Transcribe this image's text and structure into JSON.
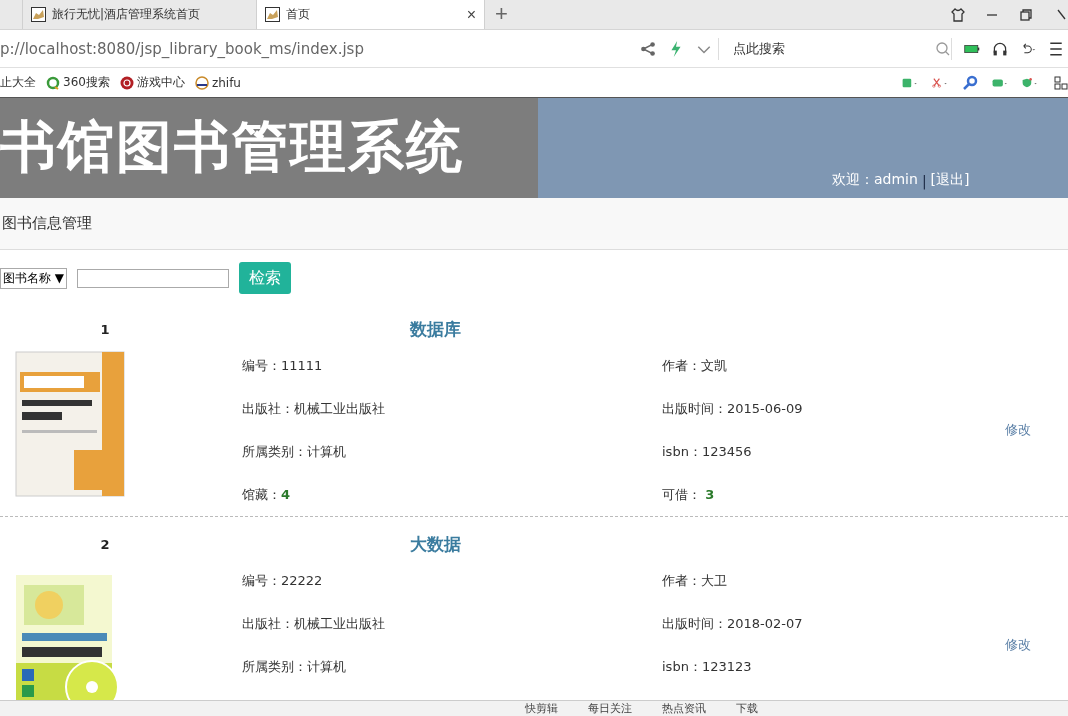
{
  "browser": {
    "tabs": [
      {
        "title": "旅行无忧|酒店管理系统首页",
        "selected": false
      },
      {
        "title": "首页",
        "selected": true
      }
    ],
    "tab_close": "×",
    "new_tab": "+",
    "address": "p://localhost:8080/jsp_library_book_ms/index.jsp",
    "search_placeholder": "点此搜索",
    "bookmarks": [
      "止大全",
      "360搜索",
      "游戏中心",
      "zhifu"
    ]
  },
  "header": {
    "title": "书馆图书管理系统",
    "welcome": "欢迎：admin",
    "separator": "|",
    "logout": "[退出]"
  },
  "nav": {
    "title": "图书信息管理"
  },
  "search": {
    "field": "图书名称",
    "arrow": "▼",
    "button": "检索"
  },
  "books": [
    {
      "number": "1",
      "title": "数据库",
      "action": "修改",
      "left": [
        {
          "label": "编号：",
          "value": "11111",
          "kind": "plain"
        },
        {
          "label": "出版社：",
          "value": "机械工业出版社",
          "kind": "plain"
        },
        {
          "label": "所属类别：",
          "value": "计算机",
          "kind": "plain"
        },
        {
          "label": "馆藏：",
          "value": "4",
          "kind": "count"
        }
      ],
      "right": [
        {
          "label": "作者：",
          "value": "文凯",
          "kind": "plain"
        },
        {
          "label": "出版时间：",
          "value": "2015-06-09",
          "kind": "plain"
        },
        {
          "label": "isbn：",
          "value": "123456",
          "kind": "plain"
        },
        {
          "label": "可借： ",
          "value": "3",
          "kind": "count"
        }
      ]
    },
    {
      "number": "2",
      "title": "大数据",
      "action": "修改",
      "left": [
        {
          "label": "编号：",
          "value": "22222",
          "kind": "plain"
        },
        {
          "label": "出版社：",
          "value": "机械工业出版社",
          "kind": "plain"
        },
        {
          "label": "所属类别：",
          "value": "计算机",
          "kind": "plain"
        }
      ],
      "right": [
        {
          "label": "作者：",
          "value": "大卫",
          "kind": "plain"
        },
        {
          "label": "出版时间：",
          "value": "2018-02-07",
          "kind": "plain"
        },
        {
          "label": "isbn：",
          "value": "123123",
          "kind": "plain"
        }
      ]
    }
  ],
  "status_bar": {
    "items": [
      "快剪辑",
      "每日关注",
      "热点资讯",
      "下载"
    ]
  }
}
